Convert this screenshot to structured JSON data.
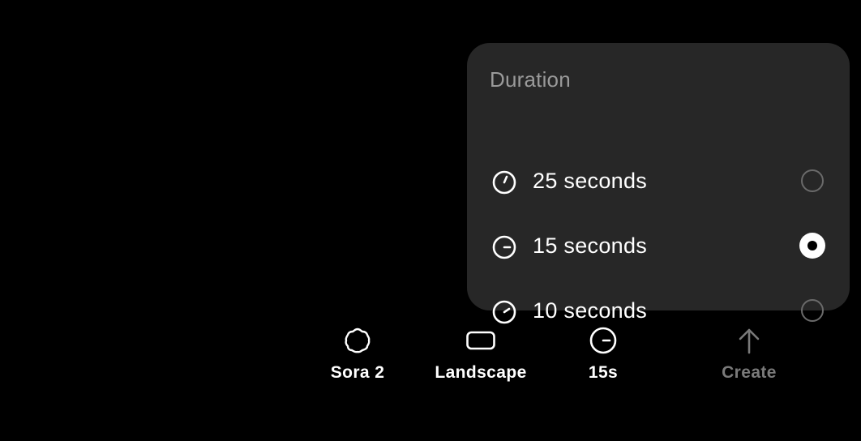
{
  "popover": {
    "title": "Duration",
    "options": [
      {
        "label": "25 seconds",
        "icon": "timer-25-icon",
        "selected": false
      },
      {
        "label": "15 seconds",
        "icon": "timer-15-icon",
        "selected": true
      },
      {
        "label": "10 seconds",
        "icon": "timer-10-icon",
        "selected": false
      }
    ]
  },
  "toolbar": {
    "model_label": "Sora 2",
    "model_icon": "blob-icon",
    "orientation_label": "Landscape",
    "orientation_icon": "landscape-rect-icon",
    "duration_label": "15s",
    "duration_icon": "timer-icon",
    "create_label": "Create",
    "create_icon": "arrow-up-icon"
  },
  "colors": {
    "background": "#000000",
    "popover_bg": "#272727",
    "title_text": "#9a9a9a",
    "disabled_text": "#7a7a7a"
  }
}
